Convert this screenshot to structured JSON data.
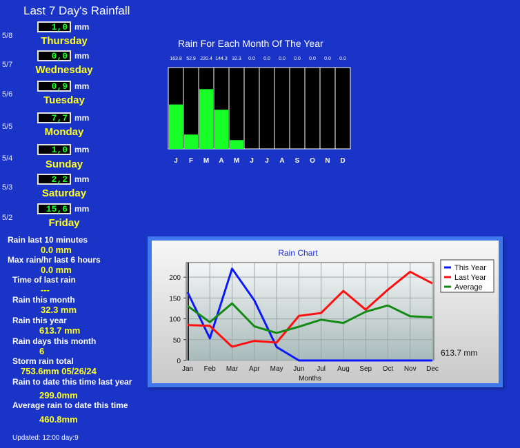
{
  "header": {
    "title": "Last 7 Day's Rainfall"
  },
  "week": [
    {
      "date": "5/8",
      "value": "1,0",
      "unit": "mm",
      "day": "Thursday"
    },
    {
      "date": "5/7",
      "value": "0,0",
      "unit": "mm",
      "day": "Wednesday"
    },
    {
      "date": "5/6",
      "value": "0,9",
      "unit": "mm",
      "day": "Tuesday"
    },
    {
      "date": "5/5",
      "value": "7,7",
      "unit": "mm",
      "day": "Monday"
    },
    {
      "date": "5/4",
      "value": "1,0",
      "unit": "mm",
      "day": "Sunday"
    },
    {
      "date": "5/3",
      "value": "2,2",
      "unit": "mm",
      "day": "Saturday"
    },
    {
      "date": "5/2",
      "value": "15,6",
      "unit": "mm",
      "day": "Friday"
    }
  ],
  "stats": [
    {
      "label": "Rain last 10 minutes",
      "value": "0.0 mm"
    },
    {
      "label": "Max rain/hr last 6 hours",
      "value": "0.0 mm"
    },
    {
      "label": "Time of last rain",
      "value": "---"
    },
    {
      "label": "Rain this month",
      "value": "32.3 mm"
    },
    {
      "label": "Rain this year",
      "value": "613.7 mm"
    },
    {
      "label": "Rain days this month",
      "value": "6"
    },
    {
      "label": "Storm rain total",
      "value": "753.6mm 05/26/24"
    },
    {
      "label": "Rain to date this time last year",
      "value": "299.0mm"
    },
    {
      "label": "Average rain to date this time",
      "value": "460.8mm"
    }
  ],
  "footer": {
    "updated": "Updated: 12:00 day:9"
  },
  "colors": {
    "background": "#1a34c8",
    "bar": "#18ff28",
    "this_year": "#0a18ff",
    "last_year": "#ff1010",
    "average": "#138a13"
  },
  "chart_data": [
    {
      "type": "bar",
      "title": "Rain For Each Month Of The Year",
      "categories": [
        "J",
        "F",
        "M",
        "A",
        "M",
        "J",
        "J",
        "A",
        "S",
        "O",
        "N",
        "D"
      ],
      "values": [
        163.8,
        52.9,
        220.4,
        144.3,
        32.3,
        0.0,
        0.0,
        0.0,
        0.0,
        0.0,
        0.0,
        0.0
      ],
      "value_labels": [
        "163.8",
        "52.9",
        "220.4",
        "144.3",
        "32.3",
        "0.0",
        "0.0",
        "0.0",
        "0.0",
        "0.0",
        "0.0",
        "0.0"
      ],
      "ylim": [
        0,
        300
      ]
    },
    {
      "type": "line",
      "title": "Rain Chart",
      "xlabel": "Months",
      "ylabel": "",
      "x": [
        "Jan",
        "Feb",
        "Mar",
        "Apr",
        "May",
        "Jun",
        "Jul",
        "Aug",
        "Sep",
        "Oct",
        "Nov",
        "Dec"
      ],
      "ylim": [
        0,
        235
      ],
      "yticks": [
        0,
        50,
        100,
        150,
        200
      ],
      "grid": true,
      "legend_position": "top-right",
      "annotation": "613.7 mm",
      "series": [
        {
          "name": "This Year",
          "values": [
            163.8,
            52.9,
            220.4,
            144.3,
            32.3,
            0,
            0,
            0,
            0,
            0,
            0,
            0
          ]
        },
        {
          "name": "Last Year",
          "values": [
            85,
            83,
            33,
            47,
            43,
            107,
            114,
            167,
            122,
            170,
            213,
            185
          ]
        },
        {
          "name": "Average",
          "values": [
            131,
            92,
            137,
            82,
            66,
            81,
            98,
            90,
            117,
            132,
            106,
            104
          ]
        }
      ]
    }
  ]
}
